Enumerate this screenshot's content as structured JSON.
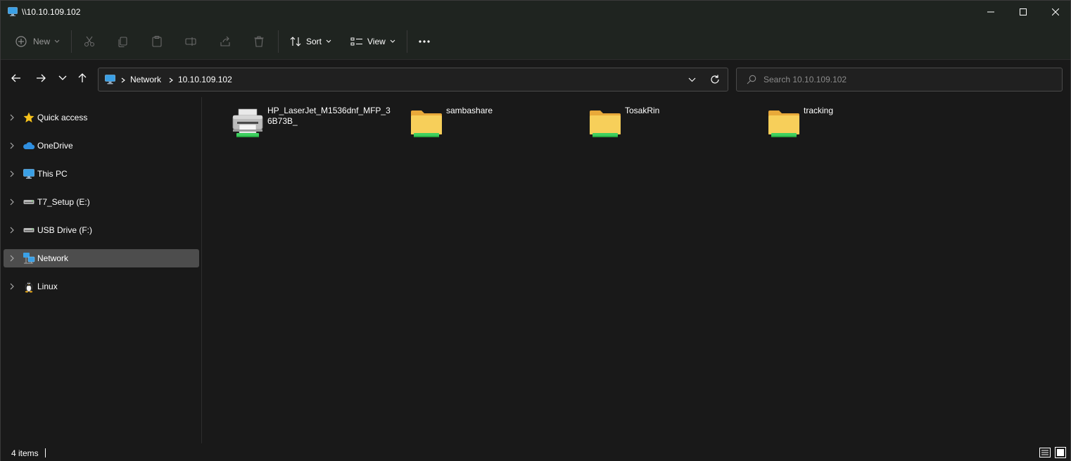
{
  "window": {
    "title": "\\\\10.10.109.102",
    "icon": "computer-icon"
  },
  "toolbar": {
    "new_label": "New",
    "sort_label": "Sort",
    "view_label": "View",
    "more_icon": "more-icon"
  },
  "address": {
    "crumbs": [
      "Network",
      "10.10.109.102"
    ]
  },
  "search": {
    "placeholder": "Search 10.10.109.102"
  },
  "sidebar": {
    "items": [
      {
        "label": "Quick access",
        "icon": "star-icon"
      },
      {
        "label": "OneDrive",
        "icon": "cloud-icon"
      },
      {
        "label": "This PC",
        "icon": "monitor-icon"
      },
      {
        "label": "T7_Setup (E:)",
        "icon": "drive-icon"
      },
      {
        "label": "USB Drive (F:)",
        "icon": "drive-icon"
      },
      {
        "label": "Network",
        "icon": "network-icon",
        "selected": true
      },
      {
        "label": "Linux",
        "icon": "penguin-icon"
      }
    ]
  },
  "content": {
    "items": [
      {
        "label": "HP_LaserJet_M1536dnf_MFP_36B73B_",
        "type": "printer"
      },
      {
        "label": "sambashare",
        "type": "folder"
      },
      {
        "label": "TosakRin",
        "type": "folder"
      },
      {
        "label": "tracking",
        "type": "folder"
      }
    ]
  },
  "status": {
    "item_count": "4 items"
  },
  "colors": {
    "background": "#191919",
    "toolbar_bg": "#1f2420",
    "selected_bg": "#4d4d4d",
    "folder_yellow": "#f4c542",
    "share_green": "#3fd060",
    "accent_blue": "#3aa0e6"
  }
}
